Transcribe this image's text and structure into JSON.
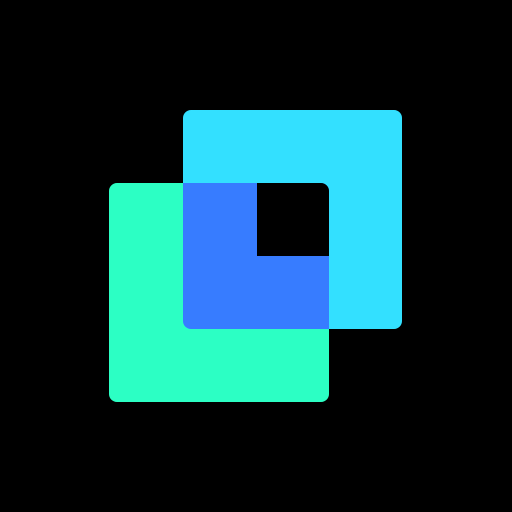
{
  "logo": {
    "icon": "overlapping-squares-logo-icon",
    "colors": {
      "background": "#000000",
      "back_square": "#2CFFC4",
      "front_square": "#33E0FF",
      "overlap": "#377CFF",
      "cutout": "#000000"
    }
  }
}
